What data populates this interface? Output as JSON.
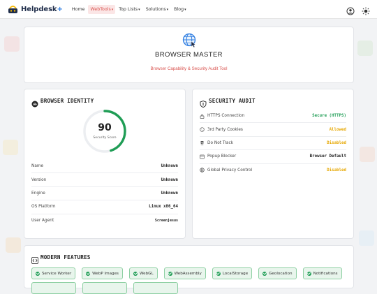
{
  "nav": {
    "brand": "Helpdesk",
    "brand_plus": "+",
    "links": [
      {
        "label": "Home",
        "caret": ""
      },
      {
        "label": "WebTools",
        "caret": "▾"
      },
      {
        "label": "Top Lists",
        "caret": "▾"
      },
      {
        "label": "Solutions",
        "caret": "▾"
      },
      {
        "label": "Blog",
        "caret": "▾"
      }
    ]
  },
  "hero": {
    "title": "BROWSER MASTER",
    "subtitle": "Browser Capability & Security Audit Tool"
  },
  "identity": {
    "title": "BROWSER IDENTITY",
    "score": "90",
    "score_label": "Security Score",
    "score_fraction": 0.9,
    "rows": [
      {
        "label": "Name",
        "value": "Unknown"
      },
      {
        "label": "Version",
        "value": "Unknown"
      },
      {
        "label": "Engine",
        "value": "Unknown"
      },
      {
        "label": "OS Platform",
        "value": "Linux x86_64"
      },
      {
        "label": "User Agent",
        "value": "Screenjesus"
      }
    ]
  },
  "audit": {
    "title": "SECURITY AUDIT",
    "rows": [
      {
        "label": "HTTPS Connection",
        "value": "Secure (HTTPS)",
        "icon": "lock-icon"
      },
      {
        "label": "3rd Party Cookies",
        "value": "Allowed",
        "icon": "cookie-icon"
      },
      {
        "label": "Do Not Track",
        "value": "Disabled",
        "icon": "user-secret-icon"
      },
      {
        "label": "Popup Blocker",
        "value": "Browser Default",
        "icon": "window-icon"
      },
      {
        "label": "Global Privacy Control",
        "value": "Disabled",
        "icon": "globe-icon"
      }
    ]
  },
  "features": {
    "title": "MODERN FEATURES",
    "items": [
      "Service Worker",
      "WebP Images",
      "WebGL",
      "WebAssembly",
      "LocalStorage",
      "Geolocation",
      "Notifications"
    ]
  },
  "colors": {
    "accent": "#d9534f",
    "success": "#1f9d55",
    "warning": "#e6a700",
    "brand_blue": "#2f7de1"
  }
}
